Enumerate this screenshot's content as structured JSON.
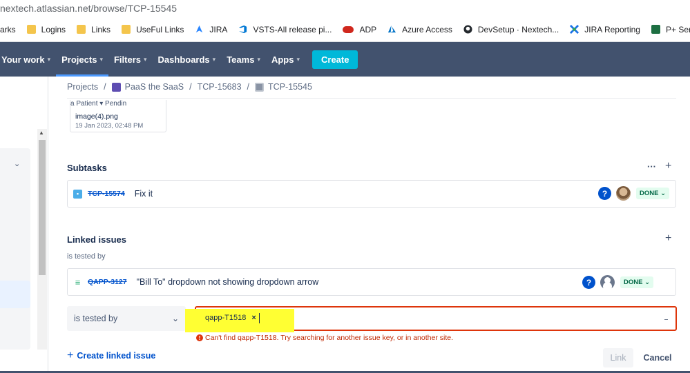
{
  "browser": {
    "url": "nextech.atlassian.net/browse/TCP-15545",
    "bookmarks": [
      {
        "label": "arks",
        "icon": "none"
      },
      {
        "label": "Logins",
        "icon": "folder-icon"
      },
      {
        "label": "Links",
        "icon": "folder-icon"
      },
      {
        "label": "UseFul Links",
        "icon": "folder-icon"
      },
      {
        "label": "JIRA",
        "icon": "jira-icon"
      },
      {
        "label": "VSTS-All release pi...",
        "icon": "vsts-icon"
      },
      {
        "label": "ADP",
        "icon": "adp-icon"
      },
      {
        "label": "Azure Access",
        "icon": "azure-icon"
      },
      {
        "label": "DevSetup · Nextech...",
        "icon": "github-icon"
      },
      {
        "label": "JIRA Reporting",
        "icon": "reporting-icon"
      },
      {
        "label": "P+ Servic",
        "icon": "excel-icon"
      }
    ]
  },
  "nav": {
    "items": [
      "Your work",
      "Projects",
      "Filters",
      "Dashboards",
      "Teams",
      "Apps"
    ],
    "create_label": "Create"
  },
  "breadcrumb": {
    "root": "Projects",
    "project": "PaaS the SaaS",
    "parent": "TCP-15683",
    "current": "TCP-15545"
  },
  "attachment": {
    "thumb_text": "a   Patient        ▾     Pendin",
    "name": "image(4).png",
    "date": "19 Jan 2023, 02:48 PM"
  },
  "subtasks": {
    "title": "Subtasks",
    "more": "···",
    "add": "+",
    "items": [
      {
        "key": "TCP-15574",
        "summary": "Fix it",
        "help": "?",
        "status": "DONE"
      }
    ]
  },
  "linked": {
    "title": "Linked issues",
    "add": "+",
    "relation": "is tested by",
    "items": [
      {
        "key": "QAPP-3127",
        "summary": "\"Bill To\" dropdown not showing dropdown arrow",
        "help": "?",
        "status": "DONE"
      }
    ]
  },
  "link_form": {
    "relation_value": "is tested by",
    "chip": "qapp-T1518",
    "chip_remove": "×",
    "error": "Can't find qapp-T1518. Try searching for another issue key, or in another site.",
    "create_linked": "Create linked issue",
    "link_label": "Link",
    "cancel_label": "Cancel"
  },
  "colors": {
    "nav_bg": "#42526e",
    "create_bg": "#00b8d9",
    "error": "#de350b",
    "highlight": "#ffff33",
    "done_bg": "#e3fcef"
  }
}
